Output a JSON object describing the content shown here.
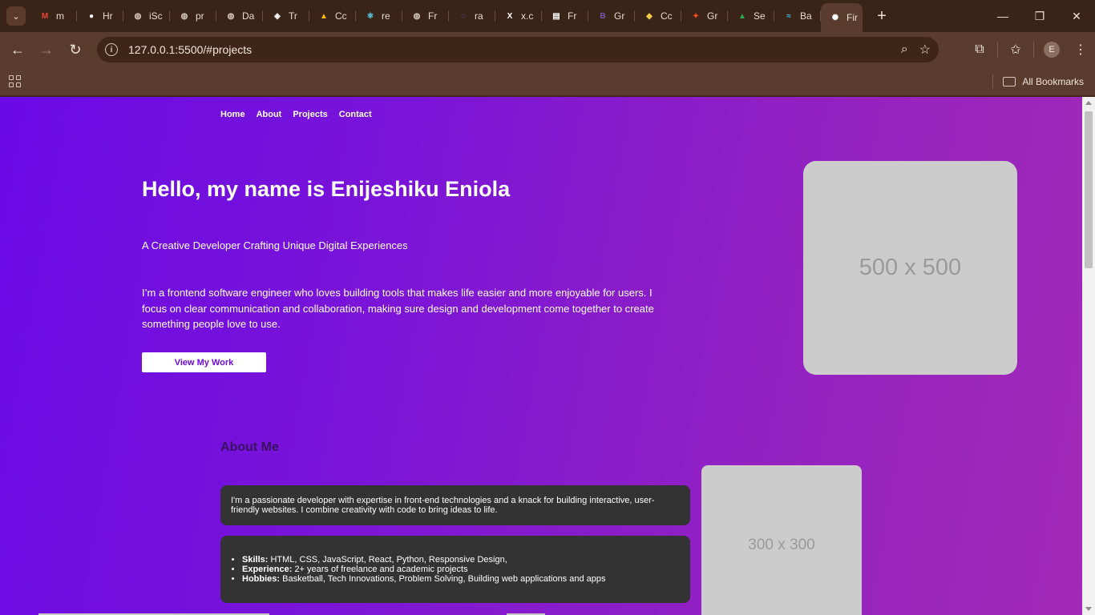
{
  "browser": {
    "tabs": [
      {
        "label": "m",
        "favicon": "gmail-icon",
        "color": "#ea4335"
      },
      {
        "label": "Hr",
        "favicon": "github-icon",
        "color": "#ffffff"
      },
      {
        "label": "iSc",
        "favicon": "globe-icon",
        "color": "#d9c7bb"
      },
      {
        "label": "pr",
        "favicon": "globe-icon",
        "color": "#d9c7bb"
      },
      {
        "label": "Da",
        "favicon": "globe-icon",
        "color": "#d9c7bb"
      },
      {
        "label": "Tr",
        "favicon": "codepen-icon",
        "color": "#ffffff"
      },
      {
        "label": "Cc",
        "favicon": "drive-icon",
        "color": "#fbbc04"
      },
      {
        "label": "re",
        "favicon": "react-icon",
        "color": "#61dafb"
      },
      {
        "label": "Fr",
        "favicon": "globe-icon",
        "color": "#d9c7bb"
      },
      {
        "label": "ra",
        "favicon": "loading-icon",
        "color": "#4a6cf7"
      },
      {
        "label": "x.c",
        "favicon": "x-icon",
        "color": "#ffffff"
      },
      {
        "label": "Fr",
        "favicon": "page-icon",
        "color": "#ffffff"
      },
      {
        "label": "Gr",
        "favicon": "bootstrap-icon",
        "color": "#7952b3"
      },
      {
        "label": "Cc",
        "favicon": "shield-icon",
        "color": "#f7c948"
      },
      {
        "label": "Gr",
        "favicon": "figma-icon",
        "color": "#f24e1e"
      },
      {
        "label": "Se",
        "favicon": "drive-icon",
        "color": "#34a853"
      },
      {
        "label": "Ba",
        "favicon": "tailwind-icon",
        "color": "#38bdf8"
      },
      {
        "label": "Fir",
        "favicon": "openai-icon",
        "color": "#ffffff"
      }
    ],
    "active_tab_close": "✕",
    "new_tab": "+",
    "url": "127.0.0.1:5500/#projects",
    "profile_initial": "E",
    "bookmarks_label": "All Bookmarks"
  },
  "site": {
    "nav": [
      "Home",
      "About",
      "Projects",
      "Contact"
    ],
    "hero": {
      "title": "Hello, my name is Enijeshiku Eniola",
      "subtitle": "A Creative Developer Crafting Unique Digital Experiences",
      "description": "I’m a frontend software engineer who loves building tools that makes life easier and more enjoyable for users. I focus on clear communication and collaboration, making sure design and development come together to create something people love to use.",
      "button": "View My Work",
      "image_placeholder": "500 x 500"
    },
    "about": {
      "title": "About Me",
      "intro": "I'm a passionate developer with expertise in front-end technologies and a knack for building interactive, user-friendly websites. I combine creativity with code to bring ideas to life.",
      "details": [
        {
          "label": "Skills:",
          "text": "HTML, CSS, JavaScript, React, Python, Responsive Design,"
        },
        {
          "label": "Experience:",
          "text": "2+ years of freelance and academic projects"
        },
        {
          "label": "Hobbies:",
          "text": "Basketball, Tech Innovations, Problem Solving, Building web applications and apps"
        }
      ],
      "image_placeholder": "300 x 300"
    }
  }
}
